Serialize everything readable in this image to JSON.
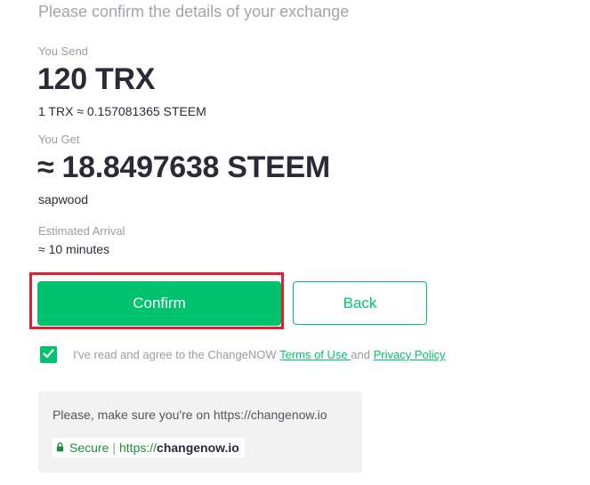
{
  "header": {
    "subtitle": "Please confirm the details of your exchange"
  },
  "send": {
    "label": "You Send",
    "amount": "120 TRX",
    "rate": "1 TRX ≈ 0.157081365 STEEM"
  },
  "get": {
    "label": "You Get",
    "amount": "≈ 18.8497638 STEEM",
    "recipient": "sapwood"
  },
  "arrival": {
    "label": "Estimated Arrival",
    "value": "≈ 10 minutes"
  },
  "actions": {
    "confirm_label": "Confirm",
    "back_label": "Back"
  },
  "agreement": {
    "checked": true,
    "prefix": "I've read and agree to the ChangeNOW ",
    "terms_label": "Terms of Use ",
    "and": " and ",
    "privacy_label": "Privacy Policy"
  },
  "notice": {
    "text": "Please, make sure you're on https://changenow.io",
    "secure_label": "Secure",
    "separator": "|",
    "protocol": "https://",
    "domain": "changenow.io"
  },
  "colors": {
    "accent": "#00c26f",
    "highlight": "#e0202f",
    "secure": "#1e8e3e"
  }
}
